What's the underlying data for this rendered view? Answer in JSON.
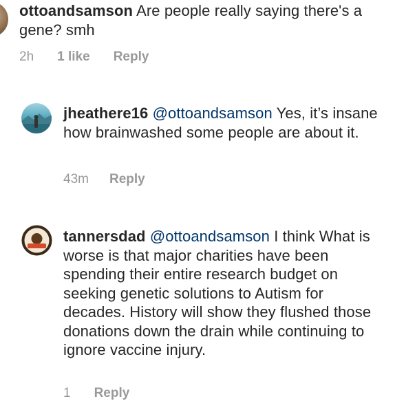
{
  "comments": [
    {
      "username": "ottoandsamson",
      "mention": "",
      "text": "Are people really saying there's a gene? smh",
      "time": "2h",
      "likes": "1 like",
      "reply": "Reply",
      "avatar_colors": [
        "#8a6a4a",
        "#c9b08f"
      ]
    },
    {
      "username": "jheathere16",
      "mention": "@ottoandsamson",
      "text": "Yes, it’s insane how brainwashed some people are about it.",
      "time": "43m",
      "likes": "",
      "reply": "Reply",
      "avatar_colors": [
        "#6fb6c7",
        "#2e6f80"
      ]
    },
    {
      "username": "tannersdad",
      "mention": "@ottoandsamson",
      "text": "I think What is worse is that major charities have been spending their entire research budget on seeking genetic solutions to Autism for decades. History will show they flushed those donations down the drain while continuing to ignore vaccine injury.",
      "time": "1",
      "likes": "",
      "reply": "Reply",
      "avatar_colors": [
        "#5a3a1a",
        "#d44a2a"
      ]
    }
  ]
}
